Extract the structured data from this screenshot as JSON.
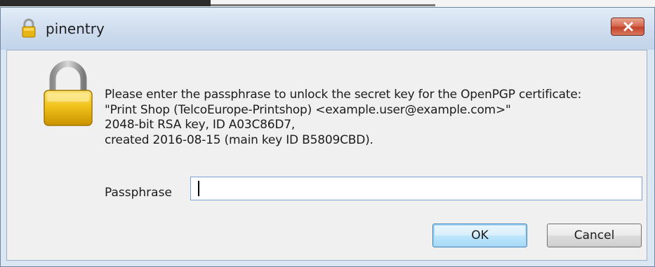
{
  "window": {
    "title": "pinentry",
    "close_symbol": "✕",
    "icons": {
      "title_icon": "lock-icon",
      "body_icon": "padlock-icon",
      "close_icon": "close-icon"
    }
  },
  "message": {
    "lines": [
      "Please enter the passphrase to unlock the secret key for the OpenPGP certificate:",
      "\"Print Shop (TelcoEurope-Printshop) <example.user@example.com>\"",
      "2048-bit RSA key, ID A03C86D7,",
      "created 2016-08-15 (main key ID B5809CBD)."
    ]
  },
  "passphrase": {
    "label": "Passphrase",
    "value": "",
    "placeholder": ""
  },
  "buttons": {
    "ok": "OK",
    "cancel": "Cancel"
  },
  "colors": {
    "titlebar": "#cedcee",
    "client_bg": "#f0f0f0",
    "close_button": "#c2442a",
    "default_button_border": "#3c7fb1"
  }
}
